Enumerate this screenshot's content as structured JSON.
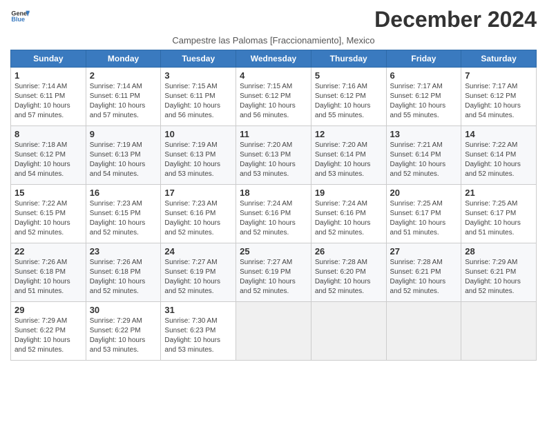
{
  "header": {
    "logo_line1": "General",
    "logo_line2": "Blue",
    "month_title": "December 2024",
    "subtitle": "Campestre las Palomas [Fraccionamiento], Mexico"
  },
  "days_of_week": [
    "Sunday",
    "Monday",
    "Tuesday",
    "Wednesday",
    "Thursday",
    "Friday",
    "Saturday"
  ],
  "weeks": [
    [
      {
        "day": "1",
        "sunrise": "7:14 AM",
        "sunset": "6:11 PM",
        "daylight": "10 hours and 57 minutes."
      },
      {
        "day": "2",
        "sunrise": "7:14 AM",
        "sunset": "6:11 PM",
        "daylight": "10 hours and 57 minutes."
      },
      {
        "day": "3",
        "sunrise": "7:15 AM",
        "sunset": "6:11 PM",
        "daylight": "10 hours and 56 minutes."
      },
      {
        "day": "4",
        "sunrise": "7:15 AM",
        "sunset": "6:12 PM",
        "daylight": "10 hours and 56 minutes."
      },
      {
        "day": "5",
        "sunrise": "7:16 AM",
        "sunset": "6:12 PM",
        "daylight": "10 hours and 55 minutes."
      },
      {
        "day": "6",
        "sunrise": "7:17 AM",
        "sunset": "6:12 PM",
        "daylight": "10 hours and 55 minutes."
      },
      {
        "day": "7",
        "sunrise": "7:17 AM",
        "sunset": "6:12 PM",
        "daylight": "10 hours and 54 minutes."
      }
    ],
    [
      {
        "day": "8",
        "sunrise": "7:18 AM",
        "sunset": "6:12 PM",
        "daylight": "10 hours and 54 minutes."
      },
      {
        "day": "9",
        "sunrise": "7:19 AM",
        "sunset": "6:13 PM",
        "daylight": "10 hours and 54 minutes."
      },
      {
        "day": "10",
        "sunrise": "7:19 AM",
        "sunset": "6:13 PM",
        "daylight": "10 hours and 53 minutes."
      },
      {
        "day": "11",
        "sunrise": "7:20 AM",
        "sunset": "6:13 PM",
        "daylight": "10 hours and 53 minutes."
      },
      {
        "day": "12",
        "sunrise": "7:20 AM",
        "sunset": "6:14 PM",
        "daylight": "10 hours and 53 minutes."
      },
      {
        "day": "13",
        "sunrise": "7:21 AM",
        "sunset": "6:14 PM",
        "daylight": "10 hours and 52 minutes."
      },
      {
        "day": "14",
        "sunrise": "7:22 AM",
        "sunset": "6:14 PM",
        "daylight": "10 hours and 52 minutes."
      }
    ],
    [
      {
        "day": "15",
        "sunrise": "7:22 AM",
        "sunset": "6:15 PM",
        "daylight": "10 hours and 52 minutes."
      },
      {
        "day": "16",
        "sunrise": "7:23 AM",
        "sunset": "6:15 PM",
        "daylight": "10 hours and 52 minutes."
      },
      {
        "day": "17",
        "sunrise": "7:23 AM",
        "sunset": "6:16 PM",
        "daylight": "10 hours and 52 minutes."
      },
      {
        "day": "18",
        "sunrise": "7:24 AM",
        "sunset": "6:16 PM",
        "daylight": "10 hours and 52 minutes."
      },
      {
        "day": "19",
        "sunrise": "7:24 AM",
        "sunset": "6:16 PM",
        "daylight": "10 hours and 52 minutes."
      },
      {
        "day": "20",
        "sunrise": "7:25 AM",
        "sunset": "6:17 PM",
        "daylight": "10 hours and 51 minutes."
      },
      {
        "day": "21",
        "sunrise": "7:25 AM",
        "sunset": "6:17 PM",
        "daylight": "10 hours and 51 minutes."
      }
    ],
    [
      {
        "day": "22",
        "sunrise": "7:26 AM",
        "sunset": "6:18 PM",
        "daylight": "10 hours and 51 minutes."
      },
      {
        "day": "23",
        "sunrise": "7:26 AM",
        "sunset": "6:18 PM",
        "daylight": "10 hours and 52 minutes."
      },
      {
        "day": "24",
        "sunrise": "7:27 AM",
        "sunset": "6:19 PM",
        "daylight": "10 hours and 52 minutes."
      },
      {
        "day": "25",
        "sunrise": "7:27 AM",
        "sunset": "6:19 PM",
        "daylight": "10 hours and 52 minutes."
      },
      {
        "day": "26",
        "sunrise": "7:28 AM",
        "sunset": "6:20 PM",
        "daylight": "10 hours and 52 minutes."
      },
      {
        "day": "27",
        "sunrise": "7:28 AM",
        "sunset": "6:21 PM",
        "daylight": "10 hours and 52 minutes."
      },
      {
        "day": "28",
        "sunrise": "7:29 AM",
        "sunset": "6:21 PM",
        "daylight": "10 hours and 52 minutes."
      }
    ],
    [
      {
        "day": "29",
        "sunrise": "7:29 AM",
        "sunset": "6:22 PM",
        "daylight": "10 hours and 52 minutes."
      },
      {
        "day": "30",
        "sunrise": "7:29 AM",
        "sunset": "6:22 PM",
        "daylight": "10 hours and 53 minutes."
      },
      {
        "day": "31",
        "sunrise": "7:30 AM",
        "sunset": "6:23 PM",
        "daylight": "10 hours and 53 minutes."
      },
      null,
      null,
      null,
      null
    ]
  ]
}
